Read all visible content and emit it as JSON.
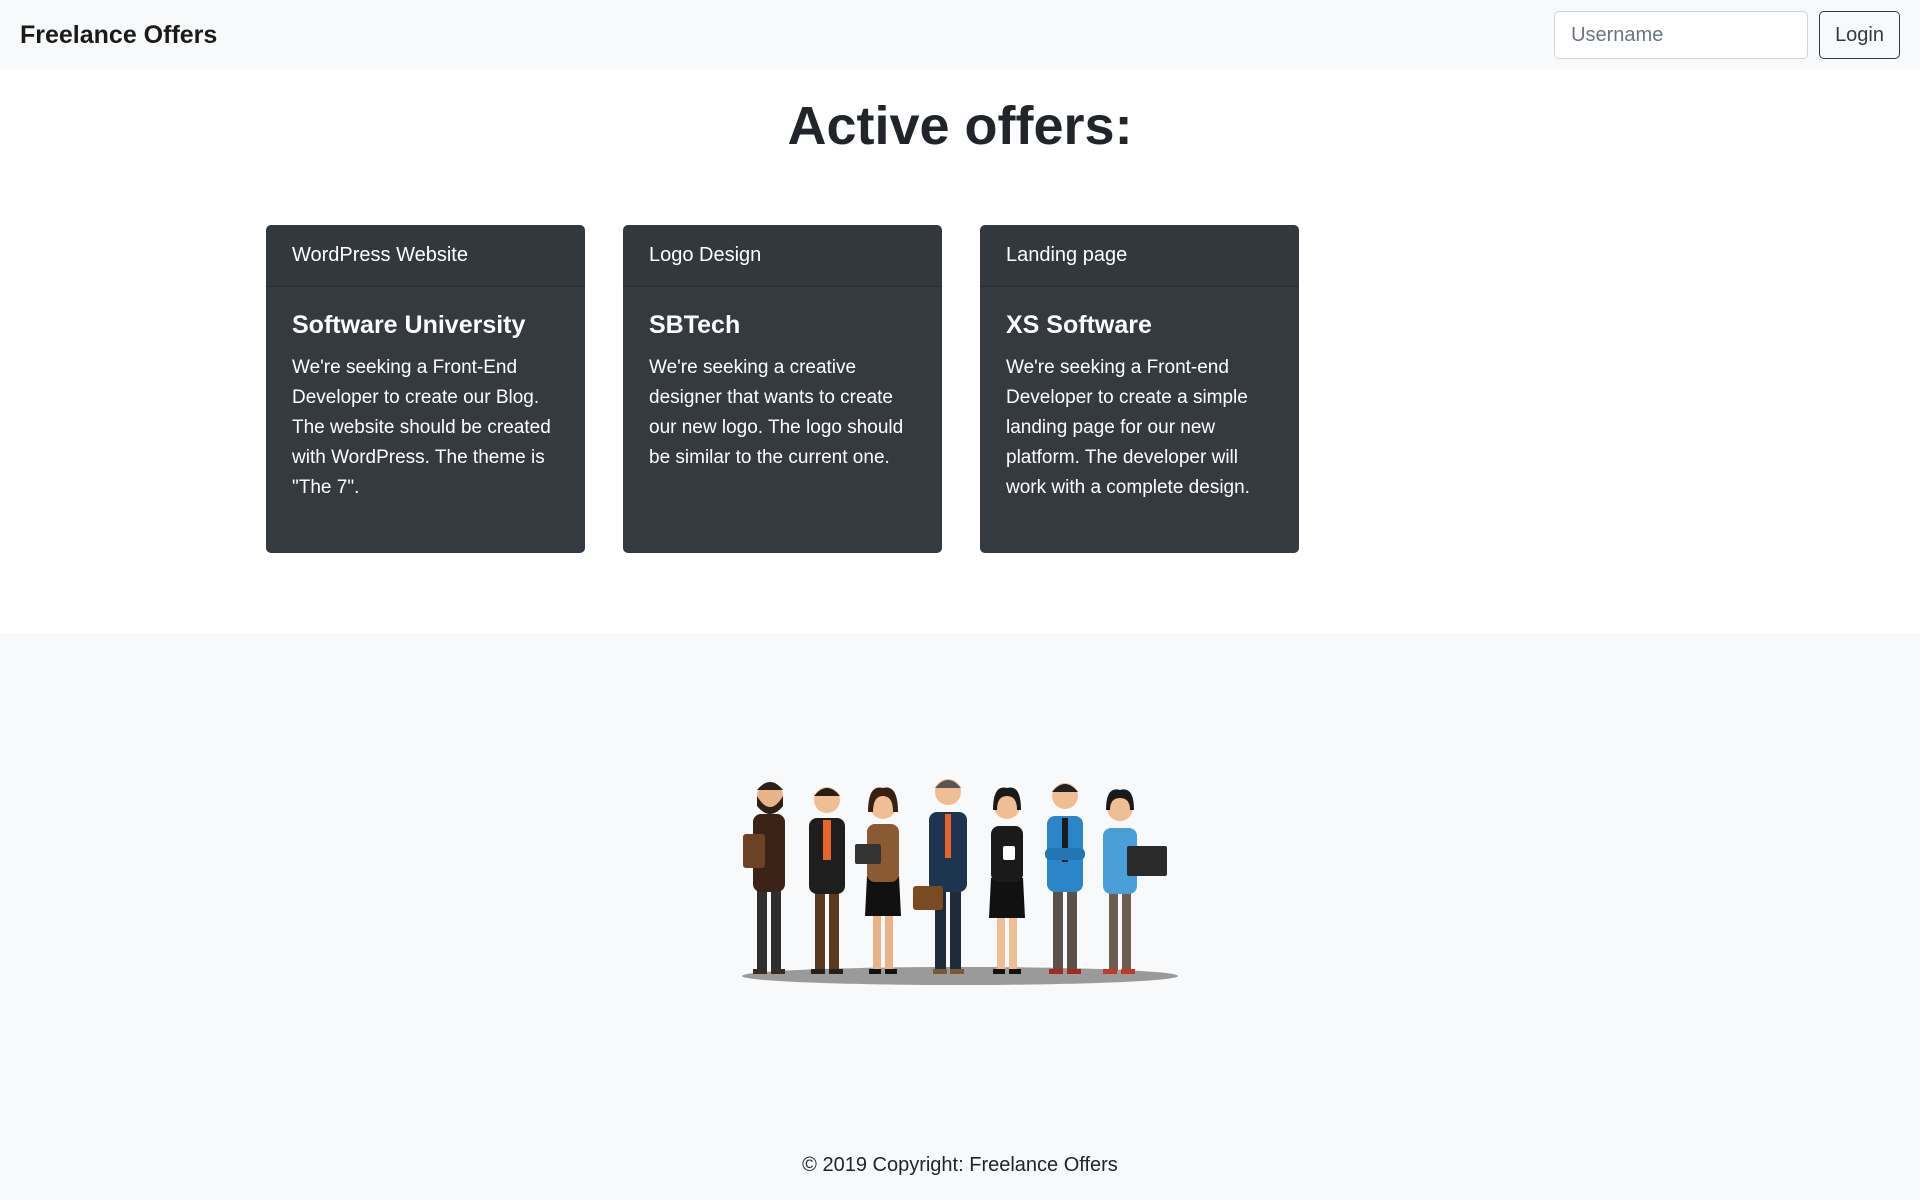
{
  "navbar": {
    "brand": "Freelance Offers",
    "username_placeholder": "Username",
    "login_label": "Login"
  },
  "main": {
    "title": "Active offers:",
    "offers": [
      {
        "category": "WordPress Website",
        "company": "Software University",
        "description": "We're seeking a Front-End Developer to create our Blog. The website should be created with WordPress. The theme is \"The 7\"."
      },
      {
        "category": "Logo Design",
        "company": "SBTech",
        "description": "We're seeking a creative designer that wants to create our new logo. The logo should be similar to the current one."
      },
      {
        "category": "Landing page",
        "company": "XS Software",
        "description": "We're seeking a Front-end Developer to create a simple landing page for our new platform. The developer will work with a complete design."
      }
    ]
  },
  "footer": {
    "illustration": "team-people-illustration",
    "copyright": "© 2019 Copyright: Freelance Offers"
  },
  "colors": {
    "navbar_bg": "#f8f9fa",
    "card_bg": "#343a40",
    "text": "#212529"
  }
}
